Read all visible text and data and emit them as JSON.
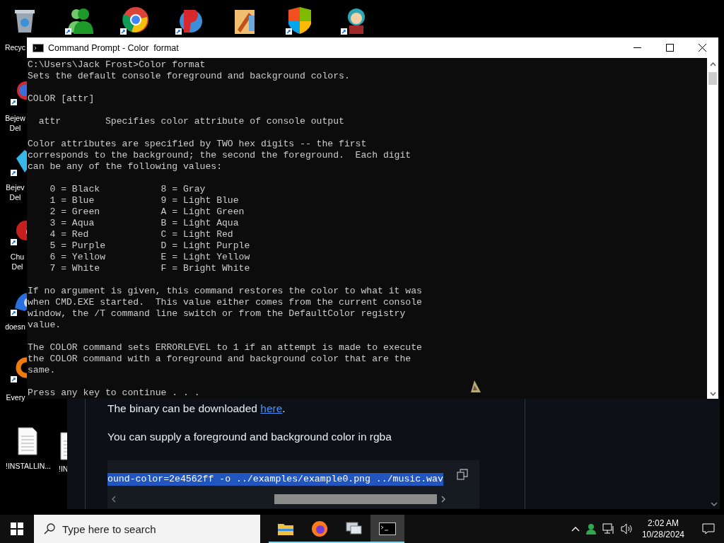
{
  "desktop_icons": [
    {
      "label": "Recyc",
      "kind": "bin",
      "shortcut": false
    },
    {
      "label": "Bejew Del",
      "kind": "swirl",
      "shortcut": true
    },
    {
      "label": "Bejev Del",
      "kind": "gem",
      "shortcut": true
    },
    {
      "label": "Chu Del",
      "kind": "creature",
      "shortcut": true
    },
    {
      "label": "doesn",
      "kind": "bird",
      "shortcut": true
    },
    {
      "label": "Every",
      "kind": "ring",
      "shortcut": true
    },
    {
      "label": "!INSTALLIN...",
      "kind": "file",
      "shortcut": false
    },
    {
      "label": "!IN",
      "kind": "file",
      "shortcut": false
    }
  ],
  "top_icons": [
    {
      "kind": "people",
      "shortcut": true
    },
    {
      "kind": "browser",
      "shortcut": true
    },
    {
      "kind": "blob",
      "shortcut": true
    },
    {
      "kind": "folder",
      "shortcut": false
    },
    {
      "kind": "shield",
      "shortcut": true
    },
    {
      "kind": "figure",
      "shortcut": true
    }
  ],
  "console_window": {
    "title": "Command Prompt - Color  format",
    "blocks": [
      [
        "C:\\Users\\Jack Frost>Color format",
        "Sets the default console foreground and background colors."
      ],
      [
        "COLOR [attr]"
      ],
      [
        "  attr        Specifies color attribute of console output"
      ],
      [
        "Color attributes are specified by TWO hex digits -- the first",
        "corresponds to the background; the second the foreground.  Each digit",
        "can be any of the following values:"
      ],
      [
        "    0 = Black           8 = Gray",
        "    1 = Blue            9 = Light Blue",
        "    2 = Green           A = Light Green",
        "    3 = Aqua            B = Light Aqua",
        "    4 = Red             C = Light Red",
        "    5 = Purple          D = Light Purple",
        "    6 = Yellow          E = Light Yellow",
        "    7 = White           F = Bright White"
      ],
      [
        "If no argument is given, this command restores the color to what it was",
        "when CMD.EXE started.  This value either comes from the current console",
        "window, the /T command line switch or from the DefaultColor registry",
        "value."
      ],
      [
        "The COLOR command sets ERRORLEVEL to 1 if an attempt is made to execute",
        "the COLOR command with a foreground and background color that are the",
        "same."
      ],
      [
        "Press any key to continue . . ."
      ]
    ]
  },
  "browser_page": {
    "download_line": {
      "before": "The binary can be downloaded ",
      "link": "here",
      "after": "."
    },
    "paragraph": "You can supply a foreground and background color in rgba",
    "code": {
      "text": "ound-color=2e4562ff -o ../examples/example0.png ../music.wav",
      "selected": true
    }
  },
  "taskbar": {
    "search": {
      "placeholder": "Type here to search"
    },
    "apps": [
      {
        "kind": "folder",
        "running": true,
        "active": false
      },
      {
        "kind": "firefox",
        "running": true,
        "active": false
      },
      {
        "kind": "monitor",
        "running": true,
        "active": false
      },
      {
        "kind": "terminal",
        "running": true,
        "active": true
      }
    ],
    "time": "2:02 AM",
    "date": "10/28/2024"
  }
}
